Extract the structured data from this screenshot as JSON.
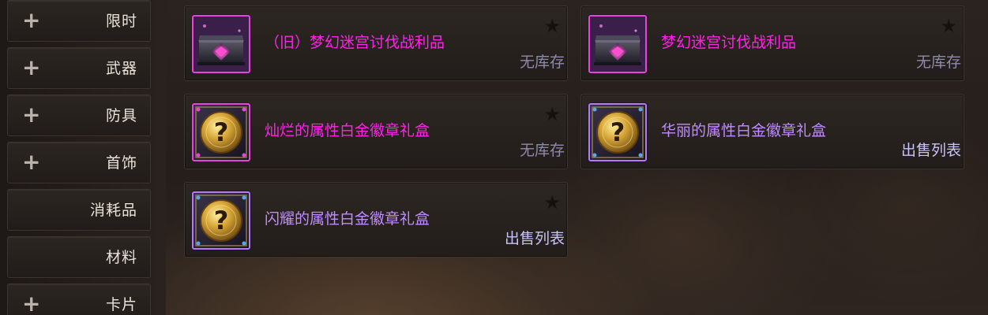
{
  "categories": [
    {
      "label": "限时",
      "expandable": true
    },
    {
      "label": "武器",
      "expandable": true
    },
    {
      "label": "防具",
      "expandable": true
    },
    {
      "label": "首饰",
      "expandable": true
    },
    {
      "label": "消耗品",
      "expandable": false
    },
    {
      "label": "材料",
      "expandable": false
    },
    {
      "label": "卡片",
      "expandable": true
    }
  ],
  "expand_symbol": "+",
  "favorite_symbol": "★",
  "items": [
    {
      "name": "（旧）梦幻迷宫讨伐战利品",
      "status": "无库存",
      "icon": "treasure-chest-icon",
      "rarity_color": "#ff22e8"
    },
    {
      "name": "梦幻迷宫讨伐战利品",
      "status": "无库存",
      "icon": "treasure-chest-icon",
      "rarity_color": "#ff22e8"
    },
    {
      "name": "灿烂的属性白金徽章礼盒",
      "status": "无库存",
      "icon": "mystery-box-icon",
      "rarity_color": "#ff22e8"
    },
    {
      "name": "华丽的属性白金徽章礼盒",
      "status": "出售列表",
      "icon": "mystery-box-icon",
      "rarity_color": "#c08cff"
    },
    {
      "name": "闪耀的属性白金徽章礼盒",
      "status": "出售列表",
      "icon": "mystery-box-icon",
      "rarity_color": "#c08cff"
    }
  ]
}
